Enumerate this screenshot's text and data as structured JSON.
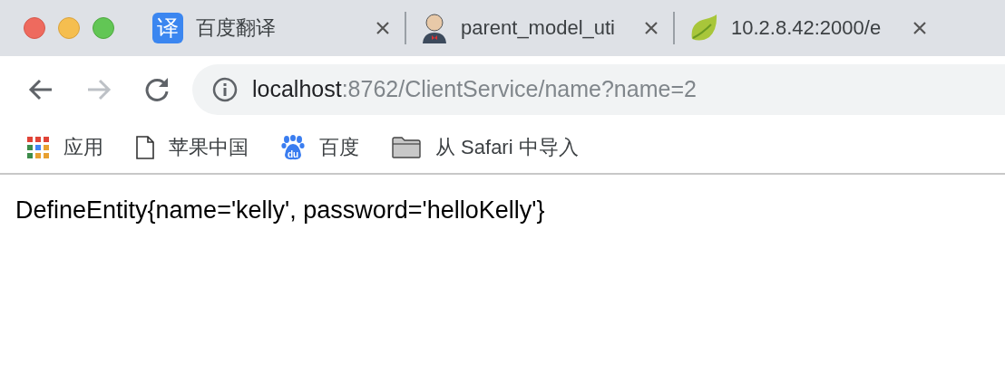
{
  "tabs": [
    {
      "title": "百度翻译",
      "kind": "glyph",
      "glyph": "译",
      "selected": false
    },
    {
      "title": "parent_model_uti",
      "kind": "figure",
      "selected": false
    },
    {
      "title": "10.2.8.42:2000/e",
      "kind": "leaf",
      "selected": false
    }
  ],
  "toolbar": {
    "back_disabled": false,
    "forward_disabled": true
  },
  "address": {
    "host": "localhost",
    "path": ":8762/ClientService/name?name=2"
  },
  "bookmarks": [
    {
      "label": "应用",
      "kind": "apps"
    },
    {
      "label": "苹果中国",
      "kind": "page"
    },
    {
      "label": "百度",
      "kind": "paw",
      "glyph": "du"
    },
    {
      "label": "从 Safari 中导入",
      "kind": "folder"
    }
  ],
  "content": {
    "text": "DefineEntity{name='kelly', password='helloKelly'}"
  }
}
